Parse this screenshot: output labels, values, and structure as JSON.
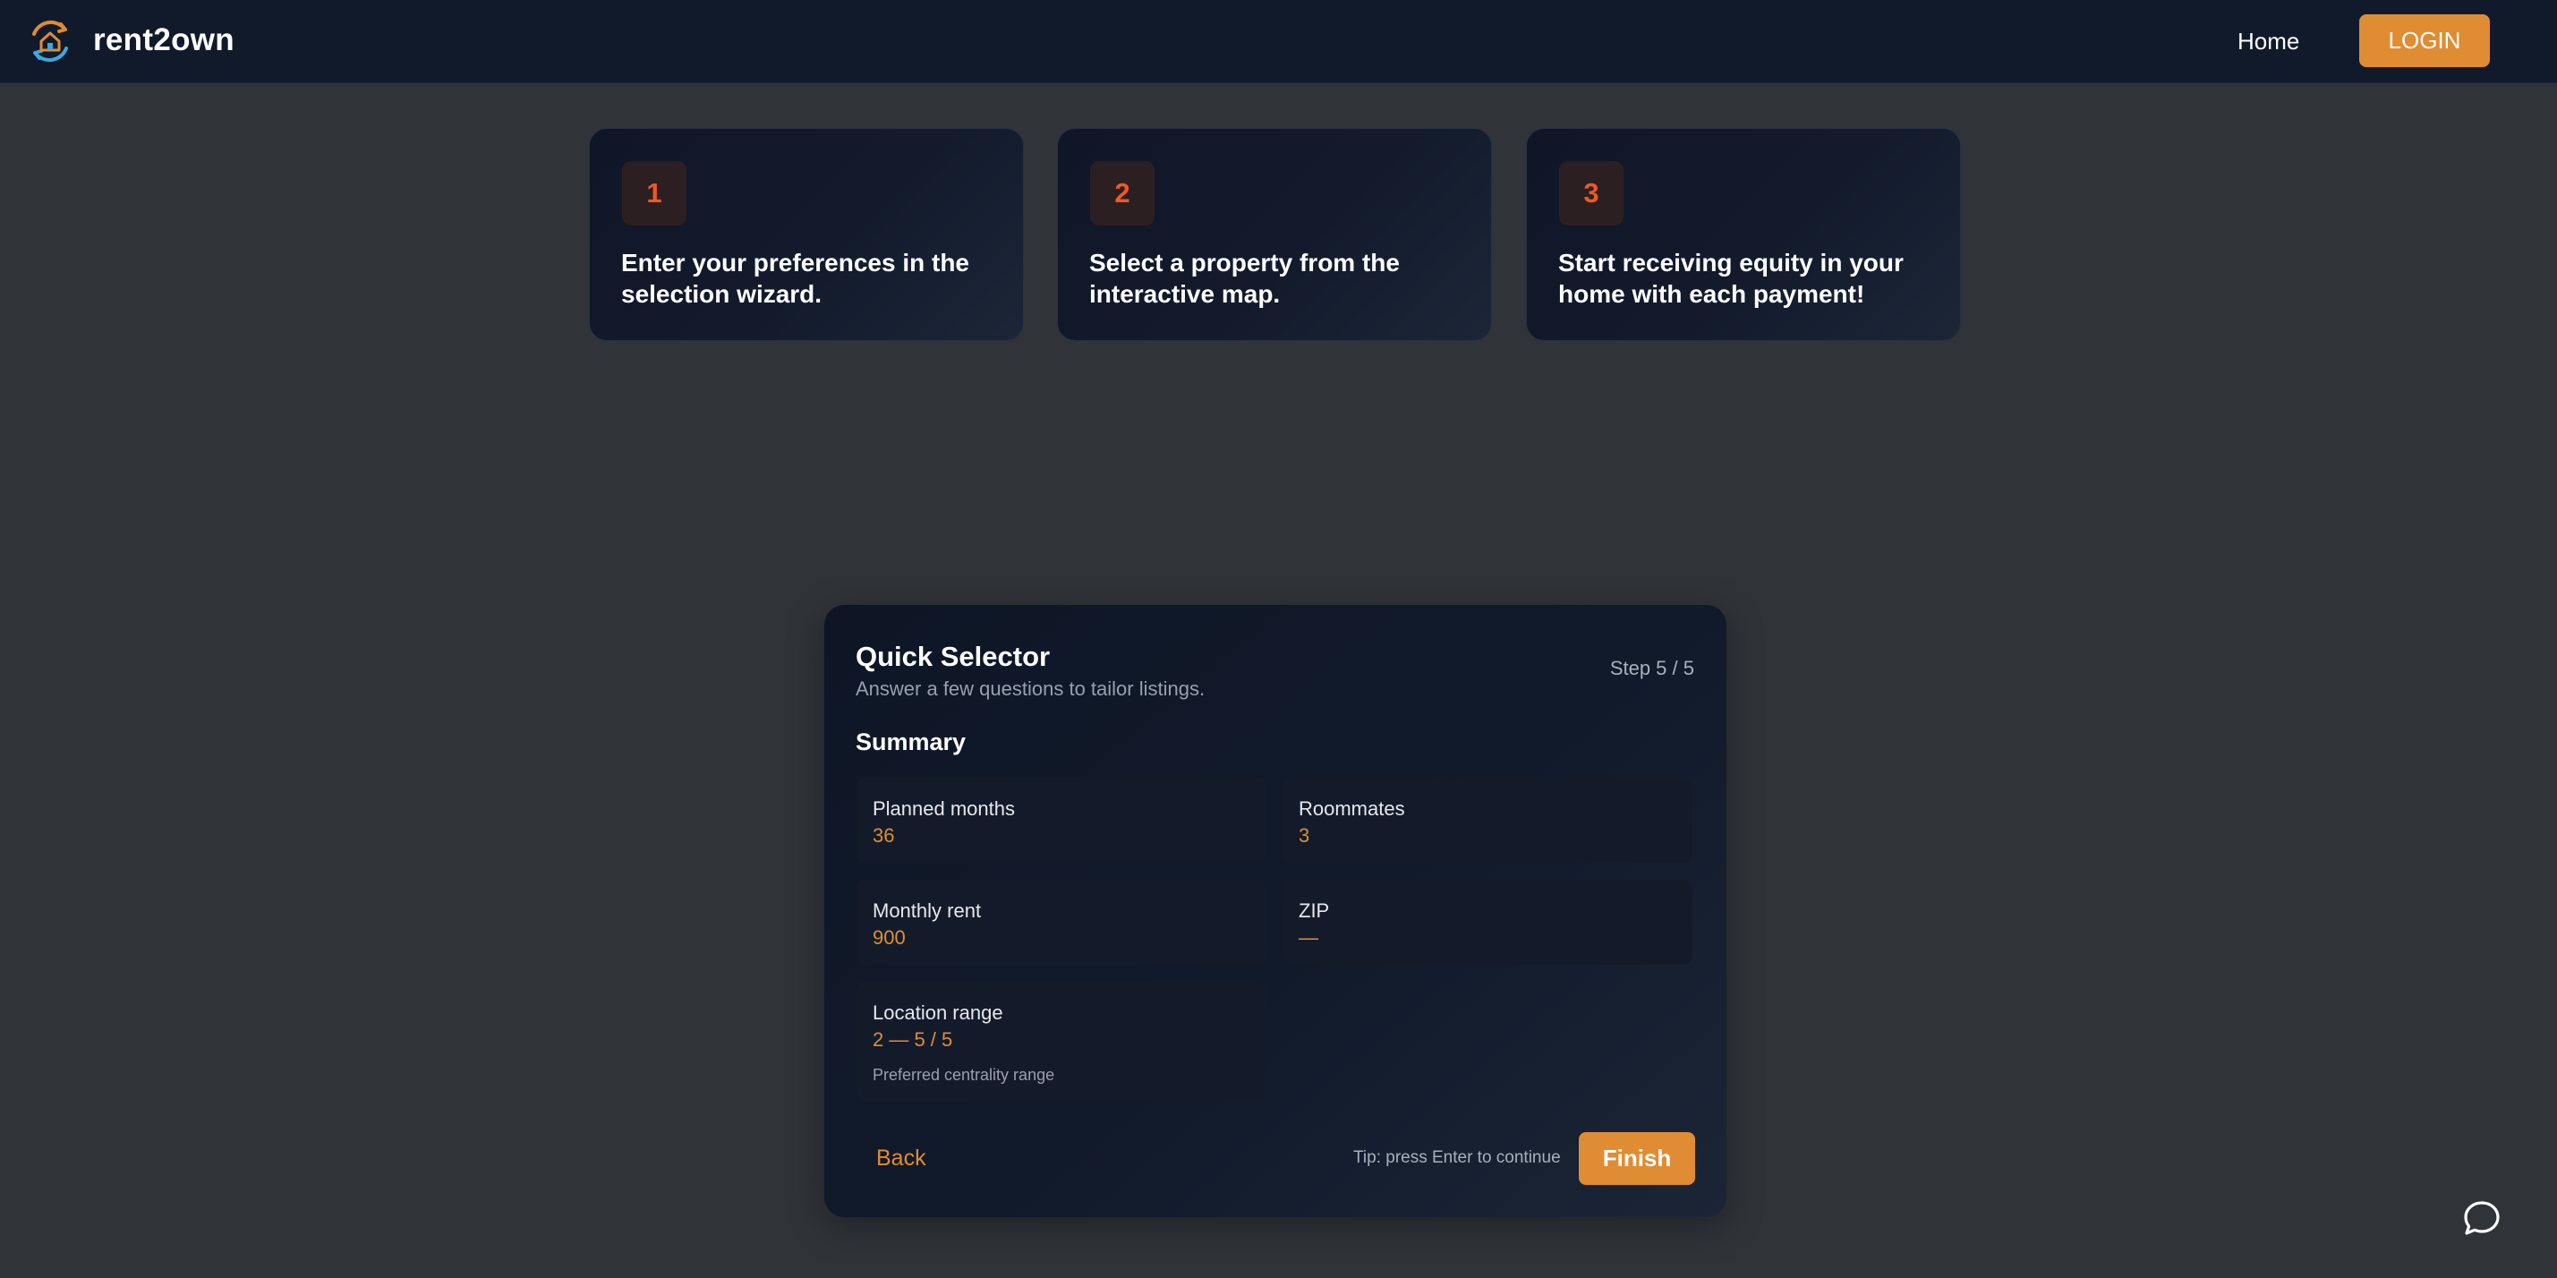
{
  "header": {
    "brand": "rent2own",
    "logo_icon": "house-arrows-icon",
    "nav": {
      "home_label": "Home",
      "login_label": "LOGIN"
    }
  },
  "steps": [
    {
      "number": "1",
      "text": "Enter your preferences in the selection wizard."
    },
    {
      "number": "2",
      "text": "Select a property from the interactive map."
    },
    {
      "number": "3",
      "text": "Start receiving equity in your home with each payment!"
    }
  ],
  "quick_selector": {
    "title": "Quick Selector",
    "subtitle": "Answer a few questions to tailor listings.",
    "step_indicator": "Step 5 / 5",
    "summary_heading": "Summary",
    "summary": {
      "planned_months": {
        "label": "Planned months",
        "value": "36"
      },
      "roommates": {
        "label": "Roommates",
        "value": "3"
      },
      "monthly_rent": {
        "label": "Monthly rent",
        "value": "900"
      },
      "zip": {
        "label": "ZIP",
        "value": "—"
      },
      "location_range": {
        "label": "Location range",
        "value": "2 — 5 / 5",
        "note": "Preferred centrality range"
      }
    },
    "back_label": "Back",
    "tip": "Tip: press Enter to continue",
    "finish_label": "Finish"
  },
  "chat": {
    "icon": "chat-bubble-icon"
  },
  "colors": {
    "accent": "#e08c33",
    "step_number": "#ed5a22",
    "header_bg": "#111a2b",
    "page_bg": "#303338",
    "panel_bg": "#111a2b"
  }
}
